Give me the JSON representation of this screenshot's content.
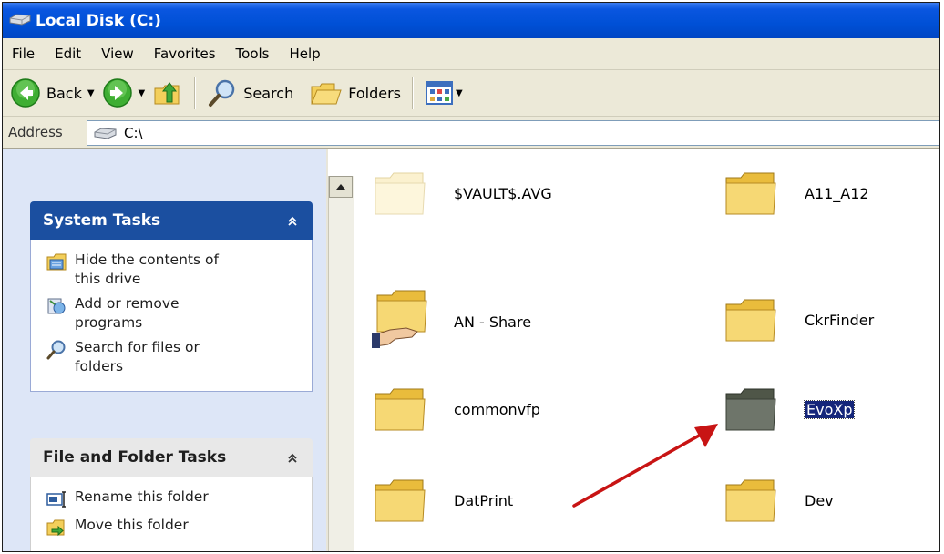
{
  "window": {
    "title": "Local Disk (C:)"
  },
  "menu": [
    "File",
    "Edit",
    "View",
    "Favorites",
    "Tools",
    "Help"
  ],
  "toolbar": {
    "back_label": "Back",
    "search_label": "Search",
    "folders_label": "Folders"
  },
  "address": {
    "label": "Address",
    "value": "C:\\"
  },
  "system_tasks": {
    "title": "System Tasks",
    "items": [
      {
        "label": "Hide the contents of this drive",
        "icon": "hide-contents-icon"
      },
      {
        "label": "Add or remove programs",
        "icon": "add-remove-programs-icon"
      },
      {
        "label": "Search for files or folders",
        "icon": "search-icon"
      }
    ]
  },
  "file_folder_tasks": {
    "title": "File and Folder Tasks",
    "items": [
      {
        "label": "Rename this folder",
        "icon": "rename-icon"
      },
      {
        "label": "Move this folder",
        "icon": "move-icon"
      }
    ]
  },
  "folders": [
    {
      "name": "$VAULT$.AVG",
      "state": "hidden"
    },
    {
      "name": "A11_A12",
      "state": "normal"
    },
    {
      "name": "AN - Share",
      "state": "shared"
    },
    {
      "name": "CkrFinder",
      "state": "normal"
    },
    {
      "name": "commonvfp",
      "state": "normal"
    },
    {
      "name": "EvoXp",
      "state": "selected"
    },
    {
      "name": "DatPrint",
      "state": "normal"
    },
    {
      "name": "Dev",
      "state": "normal"
    }
  ],
  "colors": {
    "title_bar": "#0050d6",
    "selection": "#15267a",
    "annotation_arrow": "#c81414",
    "folder_yellow": "#f6d874"
  }
}
